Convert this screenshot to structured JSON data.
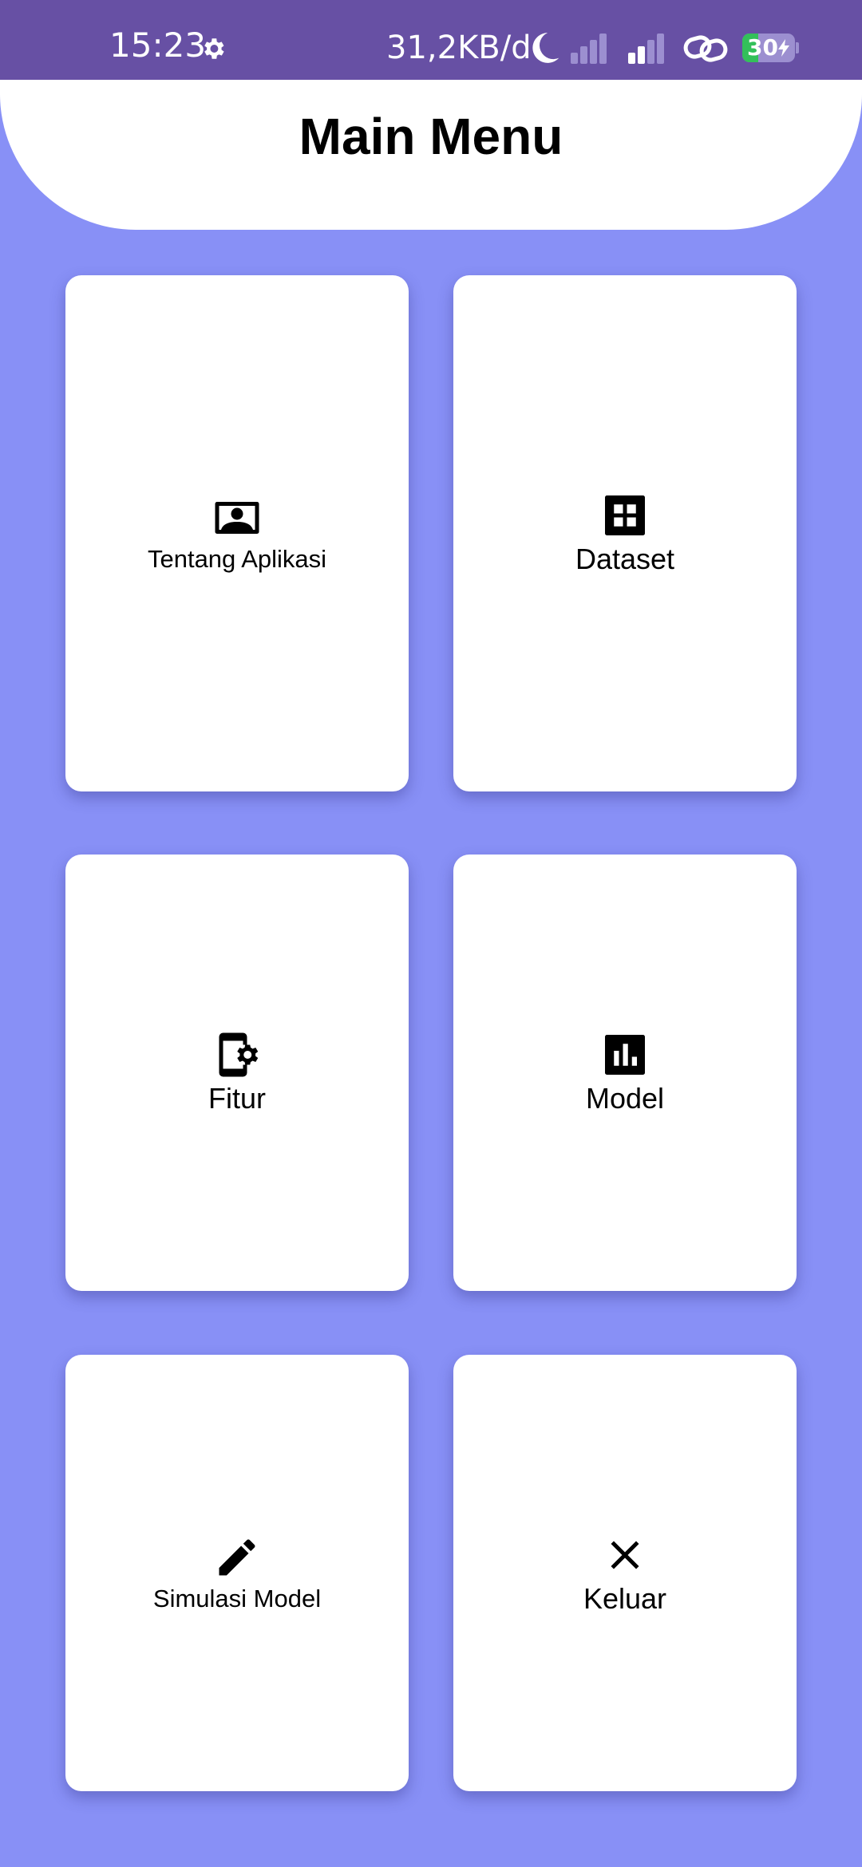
{
  "status_bar": {
    "time": "15:23",
    "network_speed": "31,2KB/d",
    "battery_level": "30",
    "battery_fraction": 0.3,
    "icons": [
      "settings-icon",
      "moon-icon",
      "signal-icon",
      "signal-icon",
      "link-icon",
      "battery-charging-icon"
    ]
  },
  "header": {
    "title": "Main Menu"
  },
  "menu": {
    "items": [
      {
        "label": "Tentang Aplikasi",
        "icon": "contact-icon"
      },
      {
        "label": "Dataset",
        "icon": "grid-icon"
      },
      {
        "label": "Fitur",
        "icon": "phone-settings-icon"
      },
      {
        "label": "Model",
        "icon": "bar-chart-icon"
      },
      {
        "label": "Simulasi Model",
        "icon": "pencil-icon"
      },
      {
        "label": "Keluar",
        "icon": "close-icon"
      }
    ]
  },
  "colors": {
    "status_bar": "#6750a4",
    "background": "#8890f6",
    "card": "#ffffff",
    "battery_fill": "#33c05a"
  }
}
